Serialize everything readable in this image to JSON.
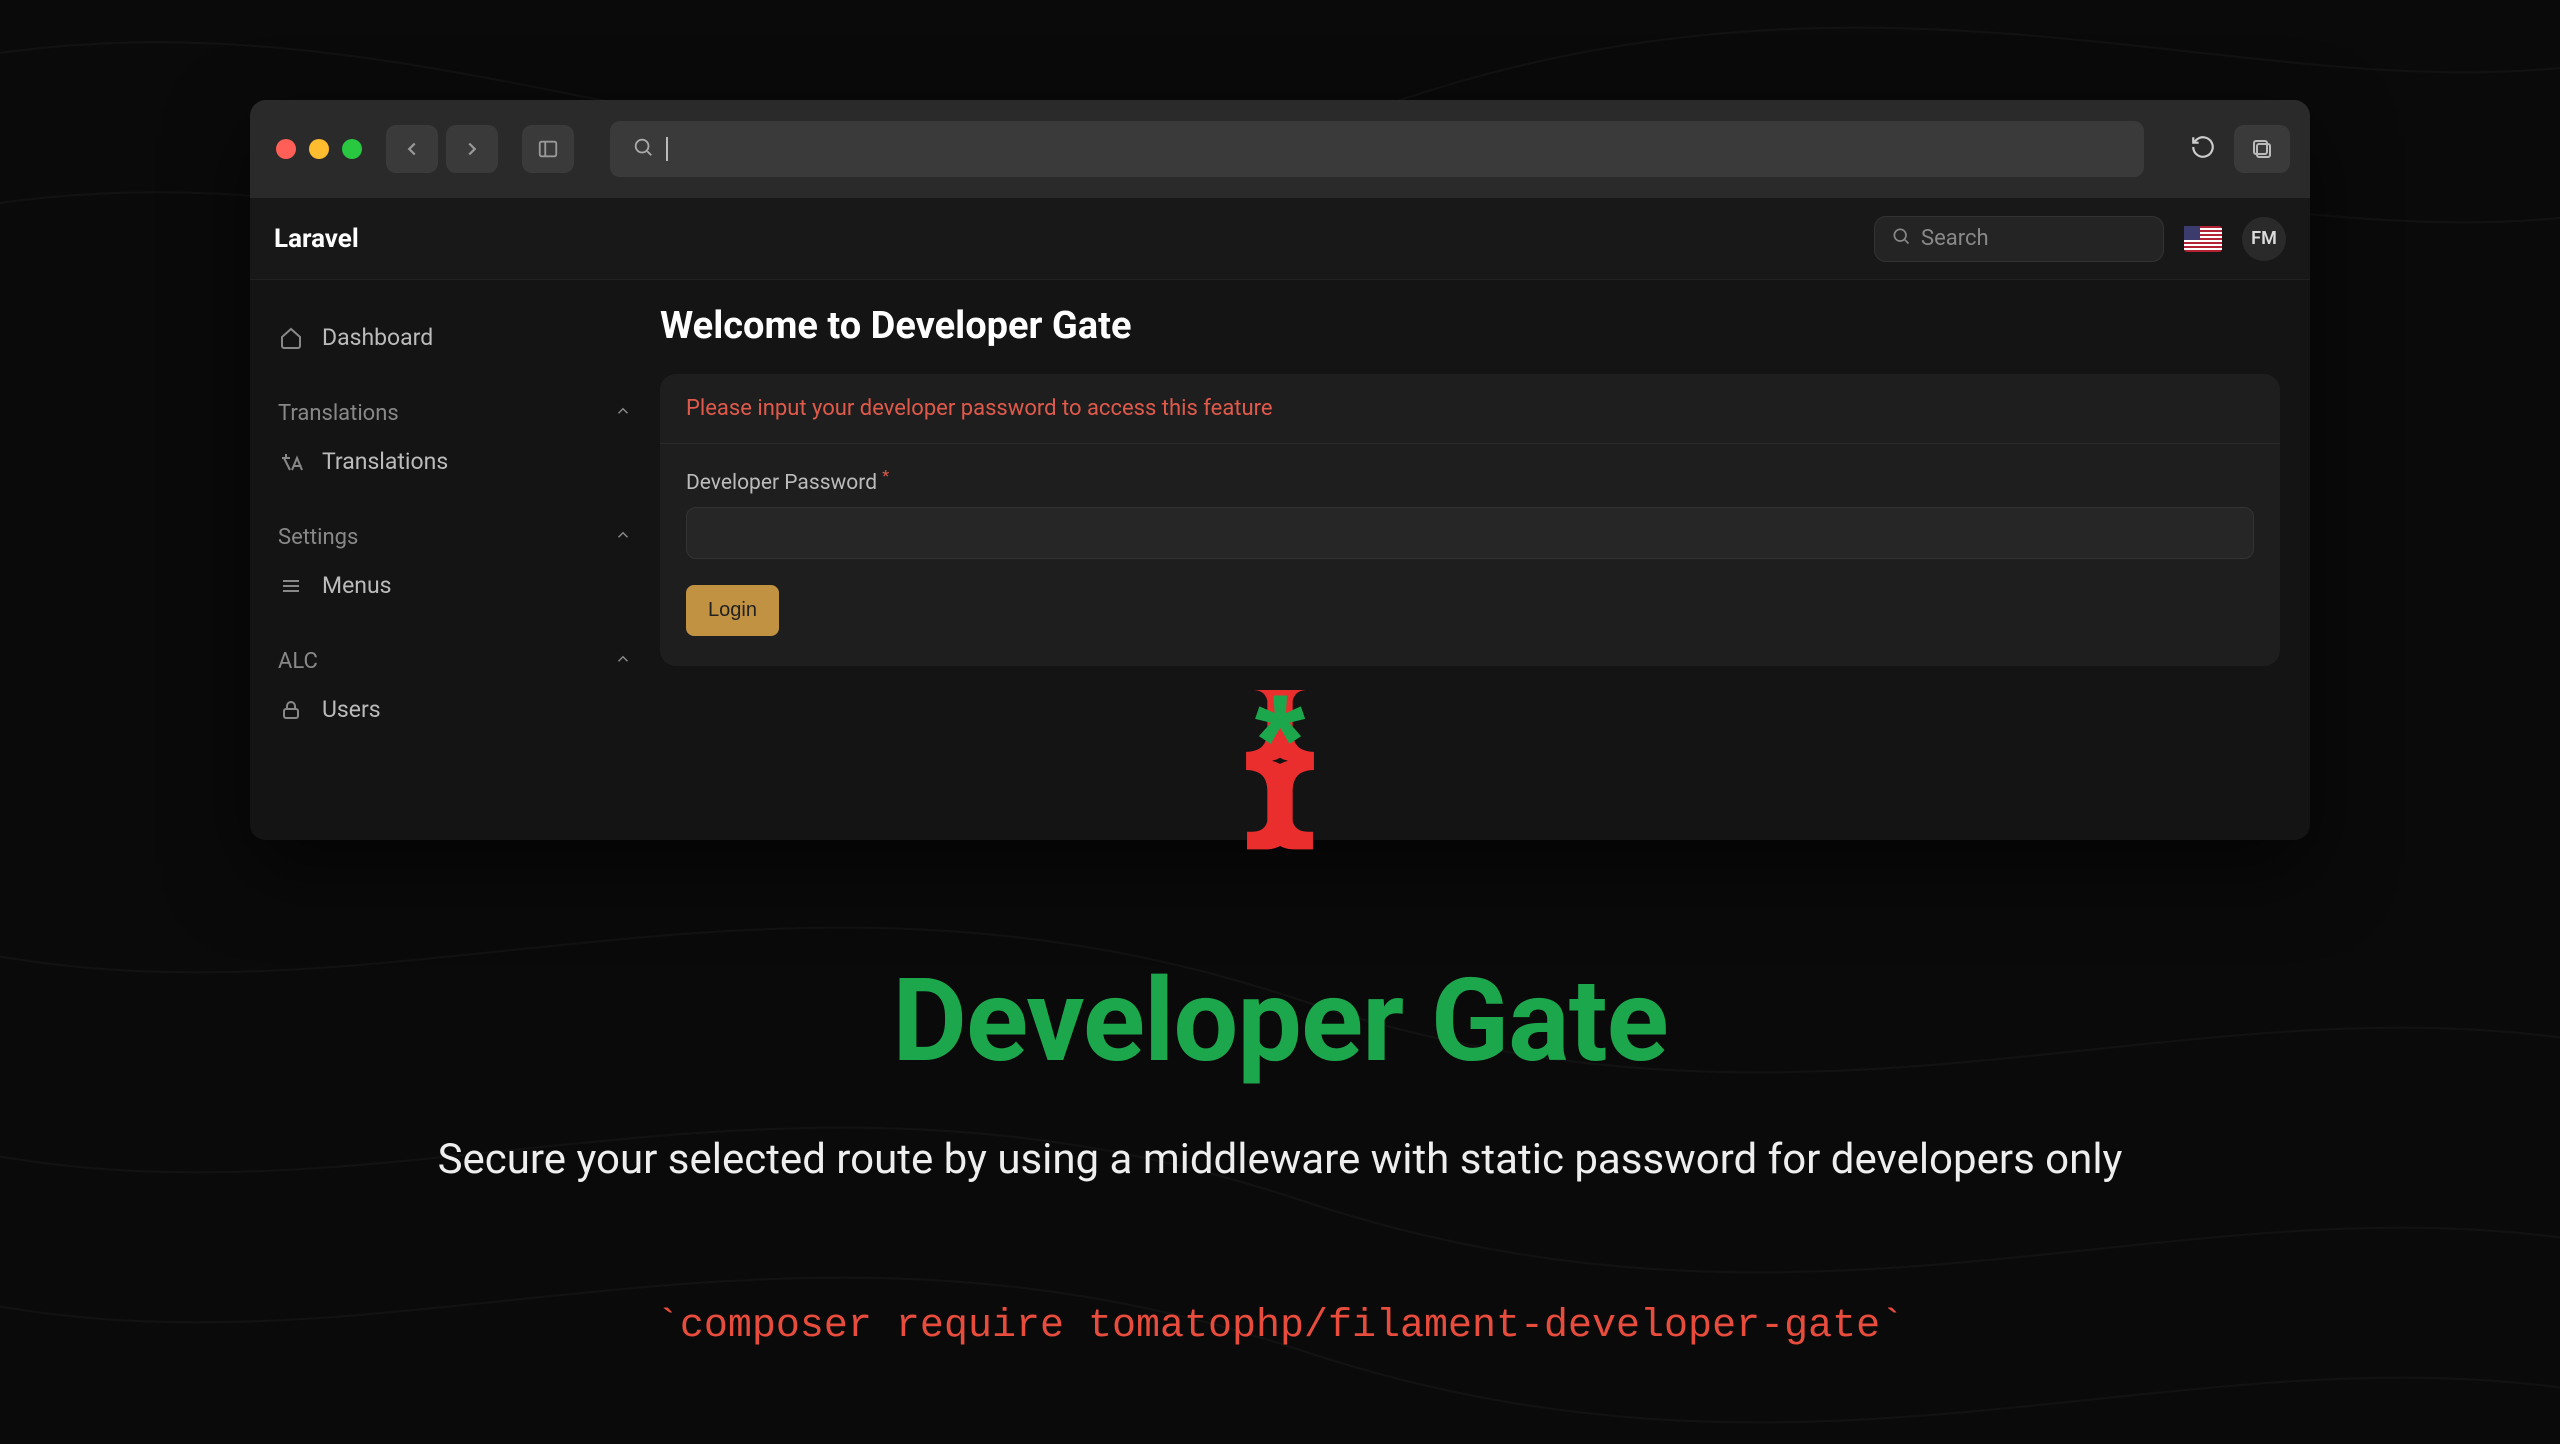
{
  "header": {
    "brand": "Laravel"
  },
  "search": {
    "placeholder": "Search"
  },
  "avatar": {
    "initials": "FM"
  },
  "sidebar": {
    "dashboard": "Dashboard",
    "sections": [
      {
        "label": "Translations",
        "item": "Translations"
      },
      {
        "label": "Settings",
        "item": "Menus"
      },
      {
        "label": "ALC",
        "item": "Users"
      }
    ]
  },
  "main": {
    "title": "Welcome to Developer Gate",
    "warning": "Please input your developer password to access this feature",
    "password_label": "Developer Password",
    "login_label": "Login"
  },
  "promo": {
    "title": "Developer Gate",
    "subtitle": "Secure your selected route by using a middleware with static password for developers only",
    "command": "`composer require tomatophp/filament-developer-gate`"
  },
  "colors": {
    "accent_green": "#1da74d",
    "accent_red": "#e84c3d",
    "button": "#c29243"
  }
}
